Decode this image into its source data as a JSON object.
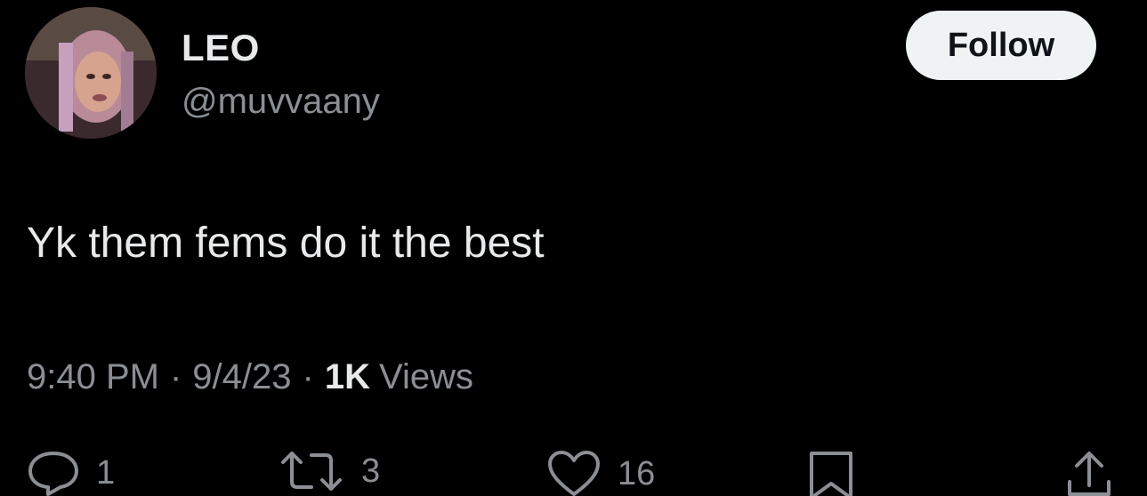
{
  "user": {
    "display_name": "LEO",
    "handle": "@muvvaany",
    "follow_label": "Follow"
  },
  "tweet": {
    "text": "Yk them fems do it the best",
    "time": "9:40 PM",
    "date": "9/4/23",
    "separator": "·",
    "views_count": "1K",
    "views_label": "Views"
  },
  "actions": {
    "reply": {
      "icon": "reply-icon",
      "count": "1"
    },
    "retweet": {
      "icon": "retweet-icon",
      "count": "3"
    },
    "like": {
      "icon": "heart-icon",
      "count": "16"
    },
    "bookmark": {
      "icon": "bookmark-icon"
    },
    "share": {
      "icon": "share-icon"
    }
  },
  "colors": {
    "background": "#000000",
    "primary_text": "#e7e9ea",
    "secondary_text": "#8b8f94",
    "follow_button_bg": "#eff3f4"
  }
}
